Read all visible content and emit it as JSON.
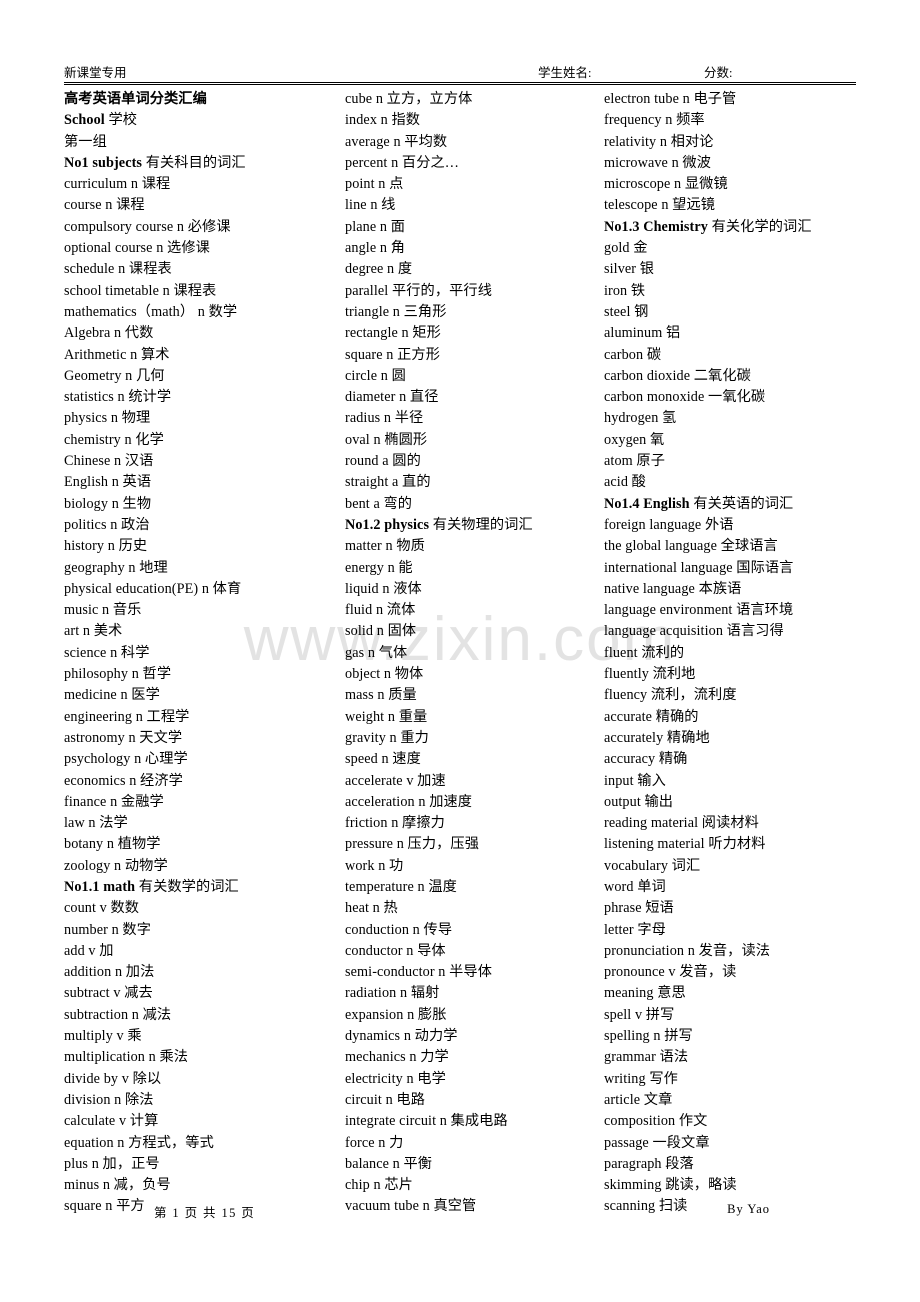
{
  "document": {
    "watermark": "www.zixin.com"
  },
  "header": {
    "left_label": "新课堂专用",
    "student_name_label": "学生姓名:",
    "score_label": "分数:"
  },
  "footer": {
    "page_number": "第 1 页 共 15 页",
    "byline": "By Yao"
  },
  "columns": [
    {
      "id": "column-1",
      "entries": [
        {
          "text": "高考英语单词分类汇编",
          "bold": true
        },
        {
          "text": "School 学校",
          "bold": true,
          "cn_start": 7
        },
        {
          "text": "第一组",
          "bold": false
        },
        {
          "text": "No1 subjects 有关科目的词汇",
          "bold": true,
          "cn_start": 13
        },
        {
          "text": "curriculum n 课程",
          "bold": false
        },
        {
          "text": "course n 课程",
          "bold": false
        },
        {
          "text": "compulsory course n 必修课",
          "bold": false
        },
        {
          "text": "optional course n 选修课",
          "bold": false
        },
        {
          "text": "schedule n 课程表",
          "bold": false
        },
        {
          "text": "school timetable n 课程表",
          "bold": false
        },
        {
          "text": "mathematics（math） n 数学",
          "bold": false
        },
        {
          "text": "Algebra n 代数",
          "bold": false
        },
        {
          "text": "Arithmetic n 算术",
          "bold": false
        },
        {
          "text": "Geometry n 几何",
          "bold": false
        },
        {
          "text": "statistics n 统计学",
          "bold": false
        },
        {
          "text": "physics n 物理",
          "bold": false
        },
        {
          "text": "chemistry n 化学",
          "bold": false
        },
        {
          "text": "Chinese n 汉语",
          "bold": false
        },
        {
          "text": "English n 英语",
          "bold": false
        },
        {
          "text": "biology n 生物",
          "bold": false
        },
        {
          "text": "politics n 政治",
          "bold": false
        },
        {
          "text": "history n 历史",
          "bold": false
        },
        {
          "text": "geography n 地理",
          "bold": false
        },
        {
          "text": "physical education(PE) n 体育",
          "bold": false
        },
        {
          "text": "music n 音乐",
          "bold": false
        },
        {
          "text": "art n 美术",
          "bold": false
        },
        {
          "text": "science n 科学",
          "bold": false
        },
        {
          "text": "philosophy n 哲学",
          "bold": false
        },
        {
          "text": "medicine n 医学",
          "bold": false
        },
        {
          "text": "engineering n 工程学",
          "bold": false
        },
        {
          "text": "astronomy n 天文学",
          "bold": false
        },
        {
          "text": "psychology n 心理学",
          "bold": false
        },
        {
          "text": "economics n 经济学",
          "bold": false
        },
        {
          "text": "finance n 金融学",
          "bold": false
        },
        {
          "text": "law n 法学",
          "bold": false
        },
        {
          "text": "botany n 植物学",
          "bold": false
        },
        {
          "text": "zoology n 动物学",
          "bold": false
        },
        {
          "text": "No1.1 math 有关数学的词汇",
          "bold": true,
          "cn_start": 11
        },
        {
          "text": "count v 数数",
          "bold": false
        },
        {
          "text": "number n 数字",
          "bold": false
        },
        {
          "text": "add v 加",
          "bold": false
        },
        {
          "text": "addition n 加法",
          "bold": false
        },
        {
          "text": "subtract v 减去",
          "bold": false
        },
        {
          "text": "subtraction n 减法",
          "bold": false
        },
        {
          "text": "multiply v 乘",
          "bold": false
        },
        {
          "text": "multiplication n 乘法",
          "bold": false
        },
        {
          "text": "divide by v 除以",
          "bold": false
        },
        {
          "text": "division n 除法",
          "bold": false
        },
        {
          "text": "calculate v 计算",
          "bold": false
        },
        {
          "text": "equation n 方程式，等式",
          "bold": false
        },
        {
          "text": "plus n 加，正号",
          "bold": false
        },
        {
          "text": "minus n 减，负号",
          "bold": false
        },
        {
          "text": "square n 平方",
          "bold": false
        }
      ]
    },
    {
      "id": "column-2",
      "entries": [
        {
          "text": "cube n 立方，立方体",
          "bold": false
        },
        {
          "text": "index n 指数",
          "bold": false
        },
        {
          "text": "average n 平均数",
          "bold": false
        },
        {
          "text": "percent n 百分之…",
          "bold": false
        },
        {
          "text": "point n 点",
          "bold": false
        },
        {
          "text": "line n 线",
          "bold": false
        },
        {
          "text": "plane n 面",
          "bold": false
        },
        {
          "text": "angle n 角",
          "bold": false
        },
        {
          "text": "degree n 度",
          "bold": false
        },
        {
          "text": "parallel 平行的，平行线",
          "bold": false
        },
        {
          "text": "triangle n 三角形",
          "bold": false
        },
        {
          "text": "rectangle n 矩形",
          "bold": false
        },
        {
          "text": "square n 正方形",
          "bold": false
        },
        {
          "text": "circle n 圆",
          "bold": false
        },
        {
          "text": "diameter n 直径",
          "bold": false
        },
        {
          "text": "radius n 半径",
          "bold": false
        },
        {
          "text": "oval n 椭圆形",
          "bold": false
        },
        {
          "text": "round a 圆的",
          "bold": false
        },
        {
          "text": "straight a 直的",
          "bold": false
        },
        {
          "text": "bent a 弯的",
          "bold": false
        },
        {
          "text": "No1.2 physics 有关物理的词汇",
          "bold": true,
          "cn_start": 14
        },
        {
          "text": "matter n 物质",
          "bold": false
        },
        {
          "text": "energy n 能",
          "bold": false
        },
        {
          "text": "liquid n 液体",
          "bold": false
        },
        {
          "text": "fluid n 流体",
          "bold": false
        },
        {
          "text": "solid n 固体",
          "bold": false
        },
        {
          "text": "gas n 气体",
          "bold": false
        },
        {
          "text": "object n 物体",
          "bold": false
        },
        {
          "text": "mass n 质量",
          "bold": false
        },
        {
          "text": "weight n 重量",
          "bold": false
        },
        {
          "text": "gravity n 重力",
          "bold": false
        },
        {
          "text": "speed n 速度",
          "bold": false
        },
        {
          "text": "accelerate v 加速",
          "bold": false
        },
        {
          "text": "acceleration n 加速度",
          "bold": false
        },
        {
          "text": "friction n 摩擦力",
          "bold": false
        },
        {
          "text": "pressure n 压力，压强",
          "bold": false
        },
        {
          "text": "work n 功",
          "bold": false
        },
        {
          "text": "temperature n 温度",
          "bold": false
        },
        {
          "text": "heat n 热",
          "bold": false
        },
        {
          "text": "conduction n 传导",
          "bold": false
        },
        {
          "text": "conductor n 导体",
          "bold": false
        },
        {
          "text": "semi-conductor n 半导体",
          "bold": false
        },
        {
          "text": "radiation n 辐射",
          "bold": false
        },
        {
          "text": "expansion n 膨胀",
          "bold": false
        },
        {
          "text": "dynamics n 动力学",
          "bold": false
        },
        {
          "text": "mechanics n 力学",
          "bold": false
        },
        {
          "text": "electricity n 电学",
          "bold": false
        },
        {
          "text": "circuit n 电路",
          "bold": false
        },
        {
          "text": "integrate circuit n 集成电路",
          "bold": false
        },
        {
          "text": "force n 力",
          "bold": false
        },
        {
          "text": "balance n 平衡",
          "bold": false
        },
        {
          "text": "chip n 芯片",
          "bold": false
        },
        {
          "text": "vacuum tube n 真空管",
          "bold": false
        }
      ]
    },
    {
      "id": "column-3",
      "entries": [
        {
          "text": "electron tube n 电子管",
          "bold": false
        },
        {
          "text": "frequency n 频率",
          "bold": false
        },
        {
          "text": "relativity n 相对论",
          "bold": false
        },
        {
          "text": "microwave n 微波",
          "bold": false
        },
        {
          "text": "microscope n 显微镜",
          "bold": false
        },
        {
          "text": "telescope n 望远镜",
          "bold": false
        },
        {
          "text": "No1.3 Chemistry 有关化学的词汇",
          "bold": true,
          "cn_start": 16
        },
        {
          "text": "gold 金",
          "bold": false
        },
        {
          "text": "silver 银",
          "bold": false
        },
        {
          "text": "iron 铁",
          "bold": false
        },
        {
          "text": "steel 钢",
          "bold": false
        },
        {
          "text": "aluminum 铝",
          "bold": false
        },
        {
          "text": "carbon 碳",
          "bold": false
        },
        {
          "text": "carbon dioxide 二氧化碳",
          "bold": false
        },
        {
          "text": "carbon monoxide 一氧化碳",
          "bold": false
        },
        {
          "text": "hydrogen 氢",
          "bold": false
        },
        {
          "text": "oxygen 氧",
          "bold": false
        },
        {
          "text": "atom 原子",
          "bold": false
        },
        {
          "text": "acid 酸",
          "bold": false
        },
        {
          "text": "No1.4 English 有关英语的词汇",
          "bold": true,
          "cn_start": 14
        },
        {
          "text": "foreign language 外语",
          "bold": false
        },
        {
          "text": "the global language 全球语言",
          "bold": false
        },
        {
          "text": "international language 国际语言",
          "bold": false
        },
        {
          "text": "native language 本族语",
          "bold": false
        },
        {
          "text": "language environment 语言环境",
          "bold": false
        },
        {
          "text": "language acquisition 语言习得",
          "bold": false
        },
        {
          "text": "fluent 流利的",
          "bold": false
        },
        {
          "text": "fluently 流利地",
          "bold": false
        },
        {
          "text": "fluency 流利，流利度",
          "bold": false
        },
        {
          "text": "accurate 精确的",
          "bold": false
        },
        {
          "text": "accurately 精确地",
          "bold": false
        },
        {
          "text": "accuracy 精确",
          "bold": false
        },
        {
          "text": "input 输入",
          "bold": false
        },
        {
          "text": "output 输出",
          "bold": false
        },
        {
          "text": "reading material 阅读材料",
          "bold": false
        },
        {
          "text": "listening material 听力材料",
          "bold": false
        },
        {
          "text": "vocabulary 词汇",
          "bold": false
        },
        {
          "text": "word 单词",
          "bold": false
        },
        {
          "text": "phrase 短语",
          "bold": false
        },
        {
          "text": "letter 字母",
          "bold": false
        },
        {
          "text": "pronunciation n 发音，读法",
          "bold": false
        },
        {
          "text": "pronounce v 发音，读",
          "bold": false
        },
        {
          "text": "meaning 意思",
          "bold": false
        },
        {
          "text": "spell v 拼写",
          "bold": false
        },
        {
          "text": "spelling n 拼写",
          "bold": false
        },
        {
          "text": "grammar 语法",
          "bold": false
        },
        {
          "text": "writing 写作",
          "bold": false
        },
        {
          "text": "article 文章",
          "bold": false
        },
        {
          "text": "composition 作文",
          "bold": false
        },
        {
          "text": "passage 一段文章",
          "bold": false
        },
        {
          "text": "paragraph 段落",
          "bold": false
        },
        {
          "text": "skimming 跳读，略读",
          "bold": false
        },
        {
          "text": "scanning 扫读",
          "bold": false
        }
      ]
    }
  ]
}
